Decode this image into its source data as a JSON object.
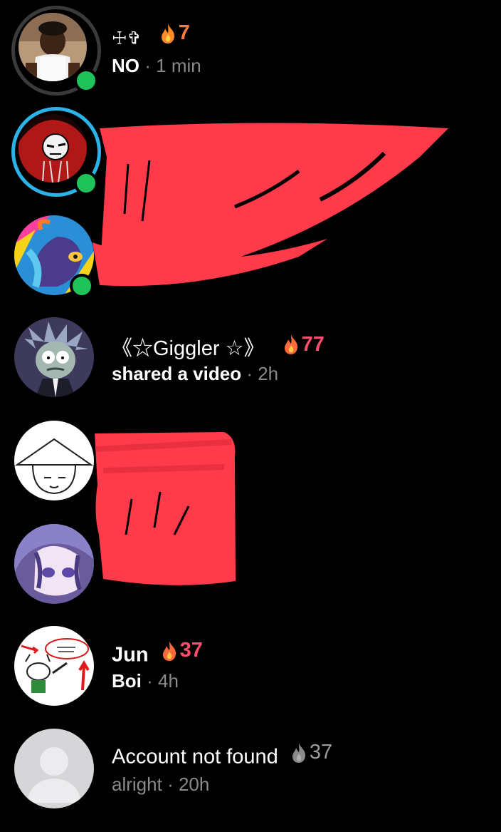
{
  "chats": [
    {
      "name": "☩✞",
      "streak": "7",
      "message": "NO",
      "time": "1 min"
    },
    {
      "name": "《☆Giggler ☆》",
      "streak": "77",
      "message": "shared a video",
      "time": "2h"
    },
    {
      "name": "Jun",
      "streak": "37",
      "message": "Boi",
      "time": "4h"
    },
    {
      "name": "Account not found",
      "streak": "37",
      "message": "alright",
      "time": "20h"
    }
  ],
  "separator": "·",
  "colors": {
    "background": "#000000",
    "online": "#20c35a",
    "streak": "#ff7a3d",
    "streak_pink": "#ff4d6d",
    "redaction": "#ff3a4a",
    "muted": "#8a8a8a"
  },
  "icons": {
    "streak": "flame-icon",
    "online": "online-indicator",
    "default_avatar": "person-silhouette-icon"
  }
}
